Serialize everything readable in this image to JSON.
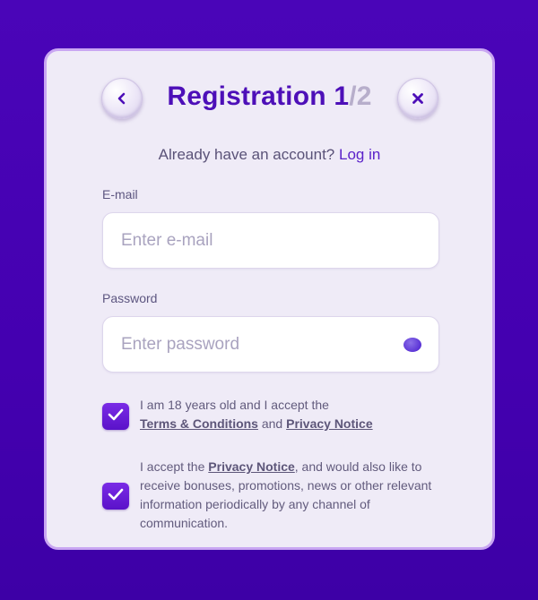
{
  "header": {
    "title": "Registration",
    "step_current": "1",
    "step_separator": "/",
    "step_total": "2"
  },
  "login_prompt": {
    "text": "Already have an account?",
    "link": "Log in"
  },
  "email": {
    "label": "E-mail",
    "placeholder": "Enter e-mail",
    "value": ""
  },
  "password": {
    "label": "Password",
    "placeholder": "Enter password",
    "value": ""
  },
  "consents": [
    {
      "checked": true,
      "text_before": "I am 18 years old and I accept the",
      "link1": "Terms & Conditions",
      "text_middle": "and",
      "link2": "Privacy Notice"
    },
    {
      "checked": true,
      "text_before": "I accept the",
      "link1": "Privacy Notice",
      "text_after": ", and would also like to receive bonuses, promotions, news or other relevant information periodically by any channel of communication."
    }
  ],
  "icons": {
    "back": "chevron-left-icon",
    "close": "close-icon",
    "toggle_password": "eye-icon",
    "checkbox": "checkmark-icon"
  },
  "colors": {
    "background": "#4a05b8",
    "card": "#efebf7",
    "card_border": "#c9a6f2",
    "title": "#4d0fb8",
    "accent": "#5b22c9",
    "checkbox": "#6a1ed8"
  }
}
